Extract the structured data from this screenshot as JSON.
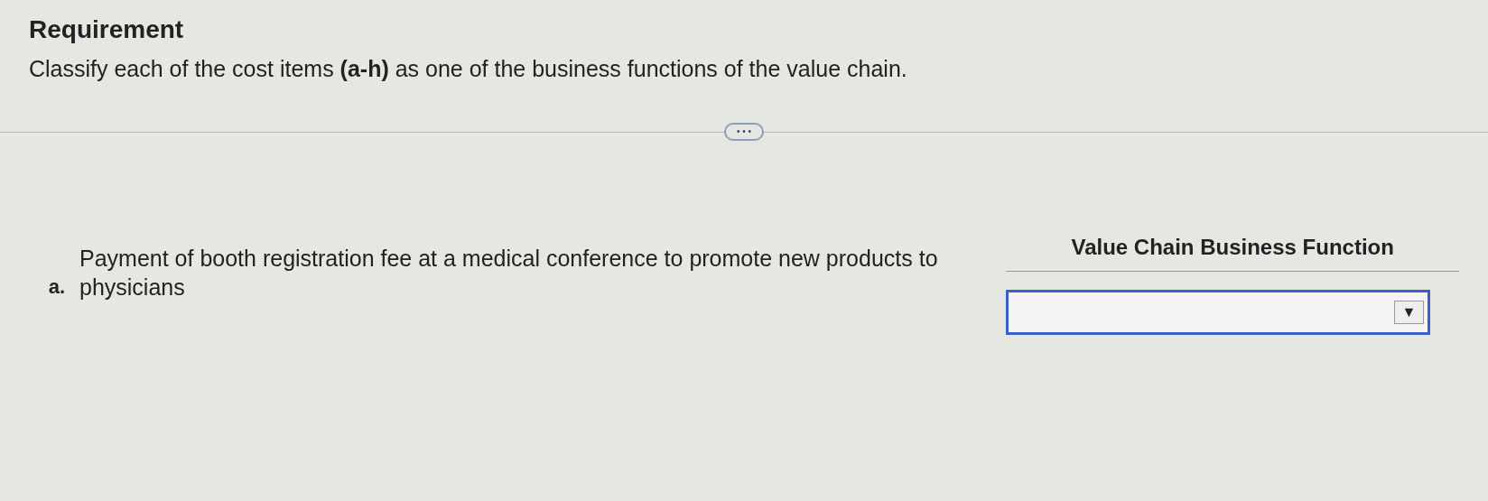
{
  "heading": "Requirement",
  "instruction": "Classify each of the cost items **(a-h)** as one of the business functions of the value chain.",
  "expand_button": "• • •",
  "column_header": "Value Chain Business Function",
  "items": [
    {
      "letter": "a.",
      "text": "Payment of booth registration fee at a medical conference to promote new products to physicians",
      "dropdown": {
        "arrow": "▼"
      }
    }
  ]
}
